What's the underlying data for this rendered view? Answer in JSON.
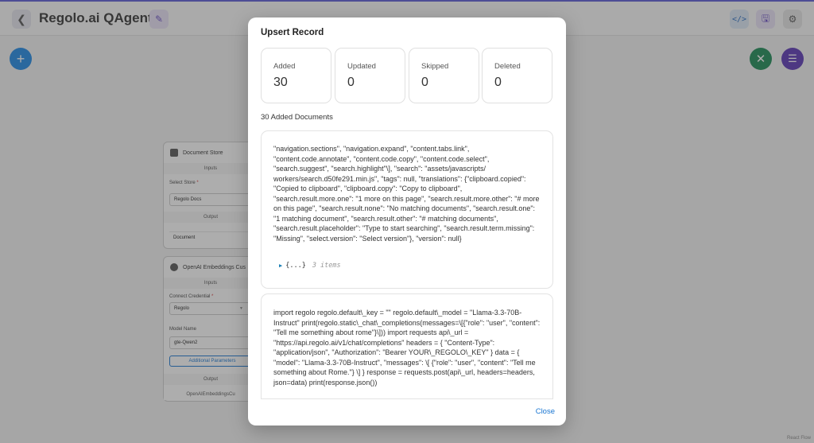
{
  "app": {
    "title": "Regolo.ai QAgent",
    "back_icon": "chevron-left-icon",
    "edit_icon": "pencil-icon",
    "toolbar": {
      "code_icon": "code-icon",
      "code_glyph": "</>",
      "save_icon": "save-icon",
      "settings_icon": "gear-icon"
    },
    "fab": {
      "add_glyph": "+",
      "close_glyph": "✕",
      "chat_glyph": "☰"
    },
    "watermark": "React Flow"
  },
  "nodes": {
    "document_store": {
      "title": "Document Store",
      "inputs_label": "Inputs",
      "select_store_label": "Select Store",
      "select_store_value": "Regolo Docs",
      "output_label": "Output",
      "output_value": "Document"
    },
    "embeddings": {
      "title": "OpenAI Embeddings Cus",
      "inputs_label": "Inputs",
      "credential_label": "Connect Credential",
      "credential_value": "Regolo",
      "model_label": "Model Name",
      "model_value": "gte-Qwen2",
      "additional_params": "Additional Parameters",
      "output_label": "Output",
      "output_value": "OpenAIEmbeddingsCu"
    },
    "required_mark": "*"
  },
  "modal": {
    "title": "Upsert Record",
    "stats": [
      {
        "label": "Added",
        "value": "30"
      },
      {
        "label": "Updated",
        "value": "0"
      },
      {
        "label": "Skipped",
        "value": "0"
      },
      {
        "label": "Deleted",
        "value": "0"
      }
    ],
    "documents_heading": "30 Added Documents",
    "documents": [
      {
        "text": "\"navigation.sections\", \"navigation.expand\", \"content.tabs.link\", \"content.code.annotate\", \"content.code.copy\", \"content.code.select\", \"search.suggest\", \"search.highlight\"\\], \"search\": \"assets/javascripts/ workers/search.d50fe291.min.js\", \"tags\": null, \"translations\": {\"clipboard.copied\": \"Copied to clipboard\", \"clipboard.copy\": \"Copy to clipboard\", \"search.result.more.one\": \"1 more on this page\", \"search.result.more.other\": \"# more on this page\", \"search.result.none\": \"No matching documents\", \"search.result.one\": \"1 matching document\", \"search.result.other\": \"# matching documents\", \"search.result.placeholder\": \"Type to start searching\", \"search.result.term.missing\": \"Missing\", \"select.version\": \"Select version\"}, \"version\": null}",
        "metadata_toggle": "{...}",
        "metadata_count": "3 items"
      },
      {
        "text": "import regolo regolo.default\\_key = \"\" regolo.default\\_model = \"Llama-3.3-70B-Instruct\" print(regolo.static\\_chat\\_completions(messages=\\[{\"role\": \"user\", \"content\": \"Tell me something about rome\"}\\])) import requests api\\_url = \"https://api.regolo.ai/v1/chat/completions\" headers = { \"Content-Type\": \"application/json\", \"Authorization\": \"Bearer YOUR\\_REGOLO\\_KEY\" } data = { \"model\": \"Llama-3.3-70B-Instruct\", \"messages\": \\[ {\"role\": \"user\", \"content\": \"Tell me something about Rome.\"} \\] } response = requests.post(api\\_url, headers=headers, json=data) print(response.json())"
      }
    ],
    "close_label": "Close"
  }
}
